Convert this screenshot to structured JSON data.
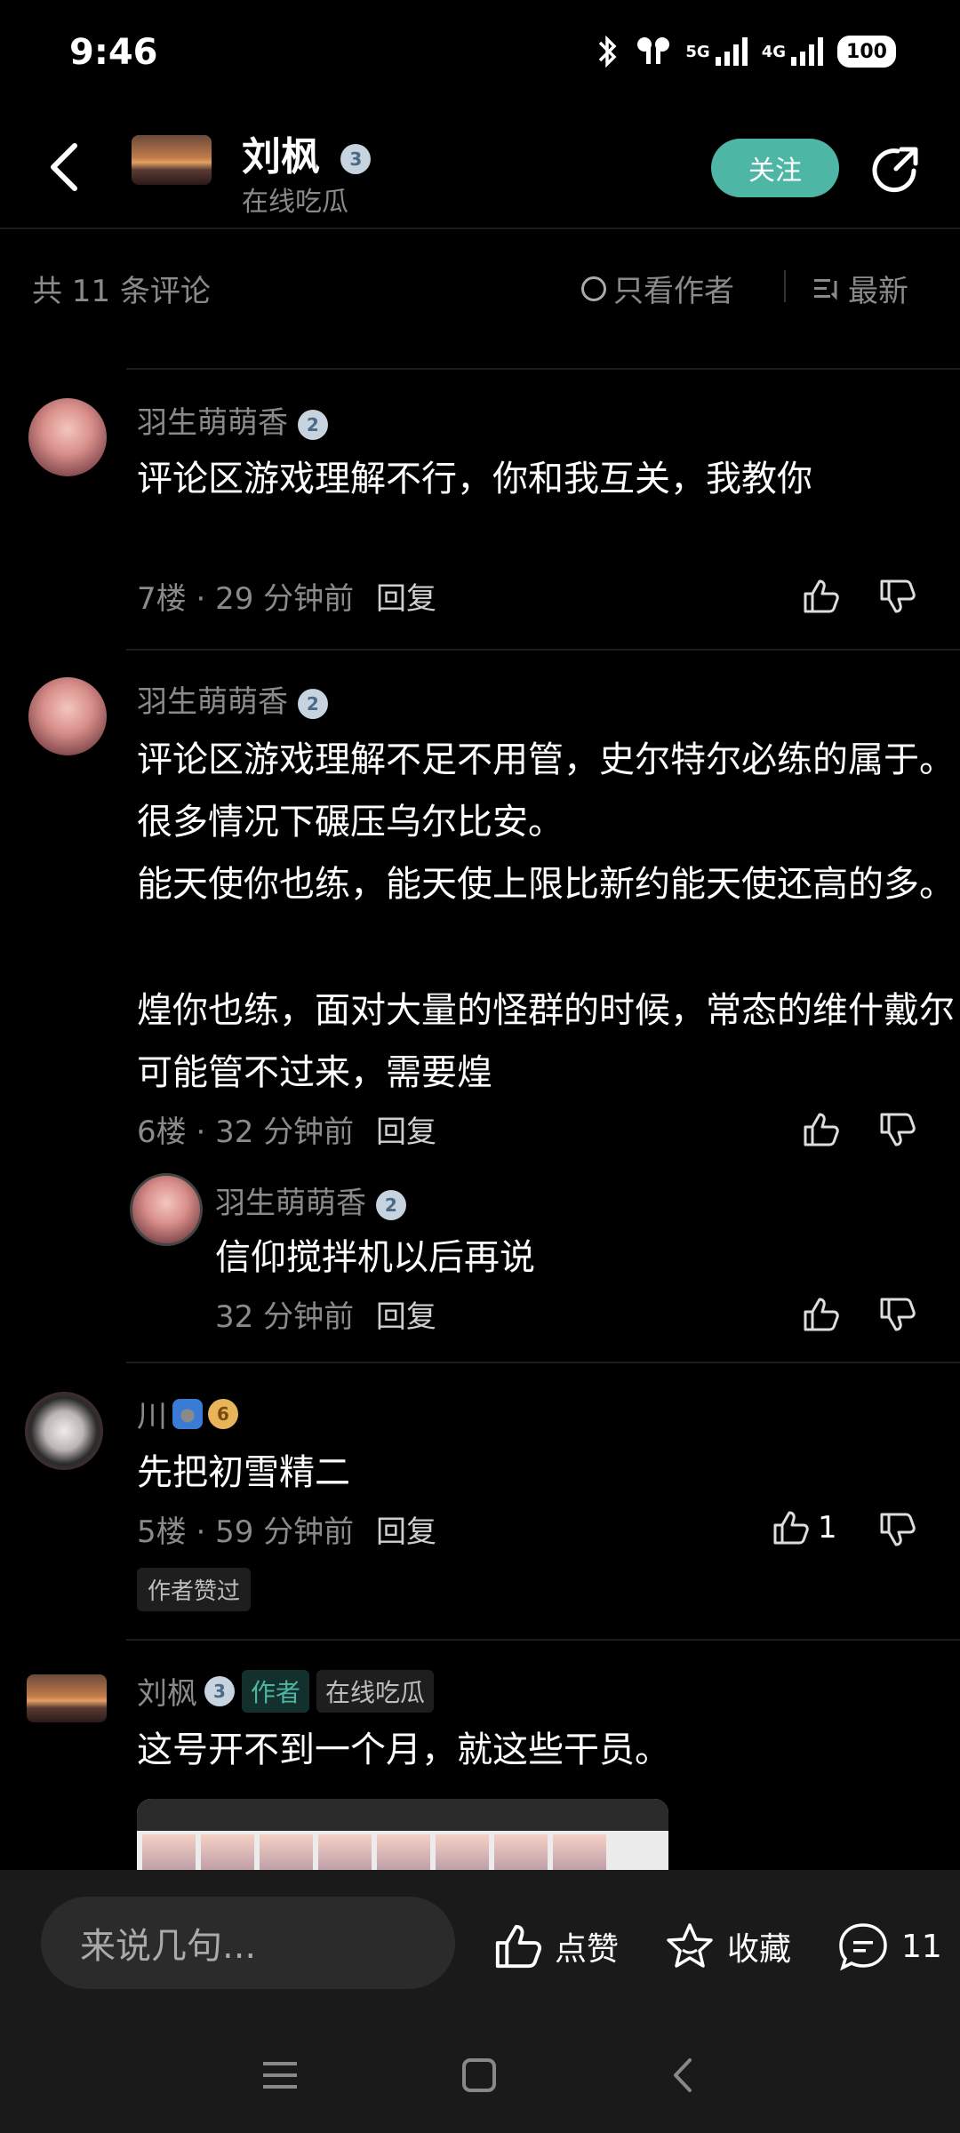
{
  "status_bar": {
    "time": "9:46",
    "network1": "5G",
    "network2": "4G",
    "battery": "100"
  },
  "header": {
    "author_name": "刘枫",
    "author_level": "3",
    "author_subtitle": "在线吃瓜",
    "follow_label": "关注"
  },
  "filter": {
    "count_label": "共 11 条评论",
    "only_author_label": "只看作者",
    "sort_label": "最新"
  },
  "comments": [
    {
      "user": "羽生萌萌香",
      "level": "2",
      "text": "评论区游戏理解不行，你和我互关，我教你",
      "floor": "7楼",
      "time": "29 分钟前",
      "reply_label": "回复"
    },
    {
      "user": "羽生萌萌香",
      "level": "2",
      "paragraphs": [
        "评论区游戏理解不足不用管，史尔特尔必练的属于。很多情况下碾压乌尔比安。",
        "能天使你也练，能天使上限比新约能天使还高的多。",
        "煌你也练，面对大量的怪群的时候，常态的维什戴尔可能管不过来，需要煌"
      ],
      "floor": "6楼",
      "time": "32 分钟前",
      "reply_label": "回复",
      "reply": {
        "user": "羽生萌萌香",
        "level": "2",
        "text": "信仰搅拌机以后再说",
        "time": "32 分钟前",
        "reply_label": "回复"
      }
    },
    {
      "user": "川",
      "level": "6",
      "text": "先把初雪精二",
      "floor": "5楼",
      "time": "59 分钟前",
      "reply_label": "回复",
      "likes": "1",
      "liked_tag": "作者赞过"
    },
    {
      "user": "刘枫",
      "level": "3",
      "author_tag": "作者",
      "title_tag": "在线吃瓜",
      "text": "这号开不到一个月，就这些干员。"
    }
  ],
  "bottom_bar": {
    "input_placeholder": "来说几句...",
    "like_label": "点赞",
    "favorite_label": "收藏",
    "comment_count": "11"
  },
  "colors": {
    "accent": "#4db6a4",
    "background": "#000000",
    "muted": "#8a8a8a"
  }
}
